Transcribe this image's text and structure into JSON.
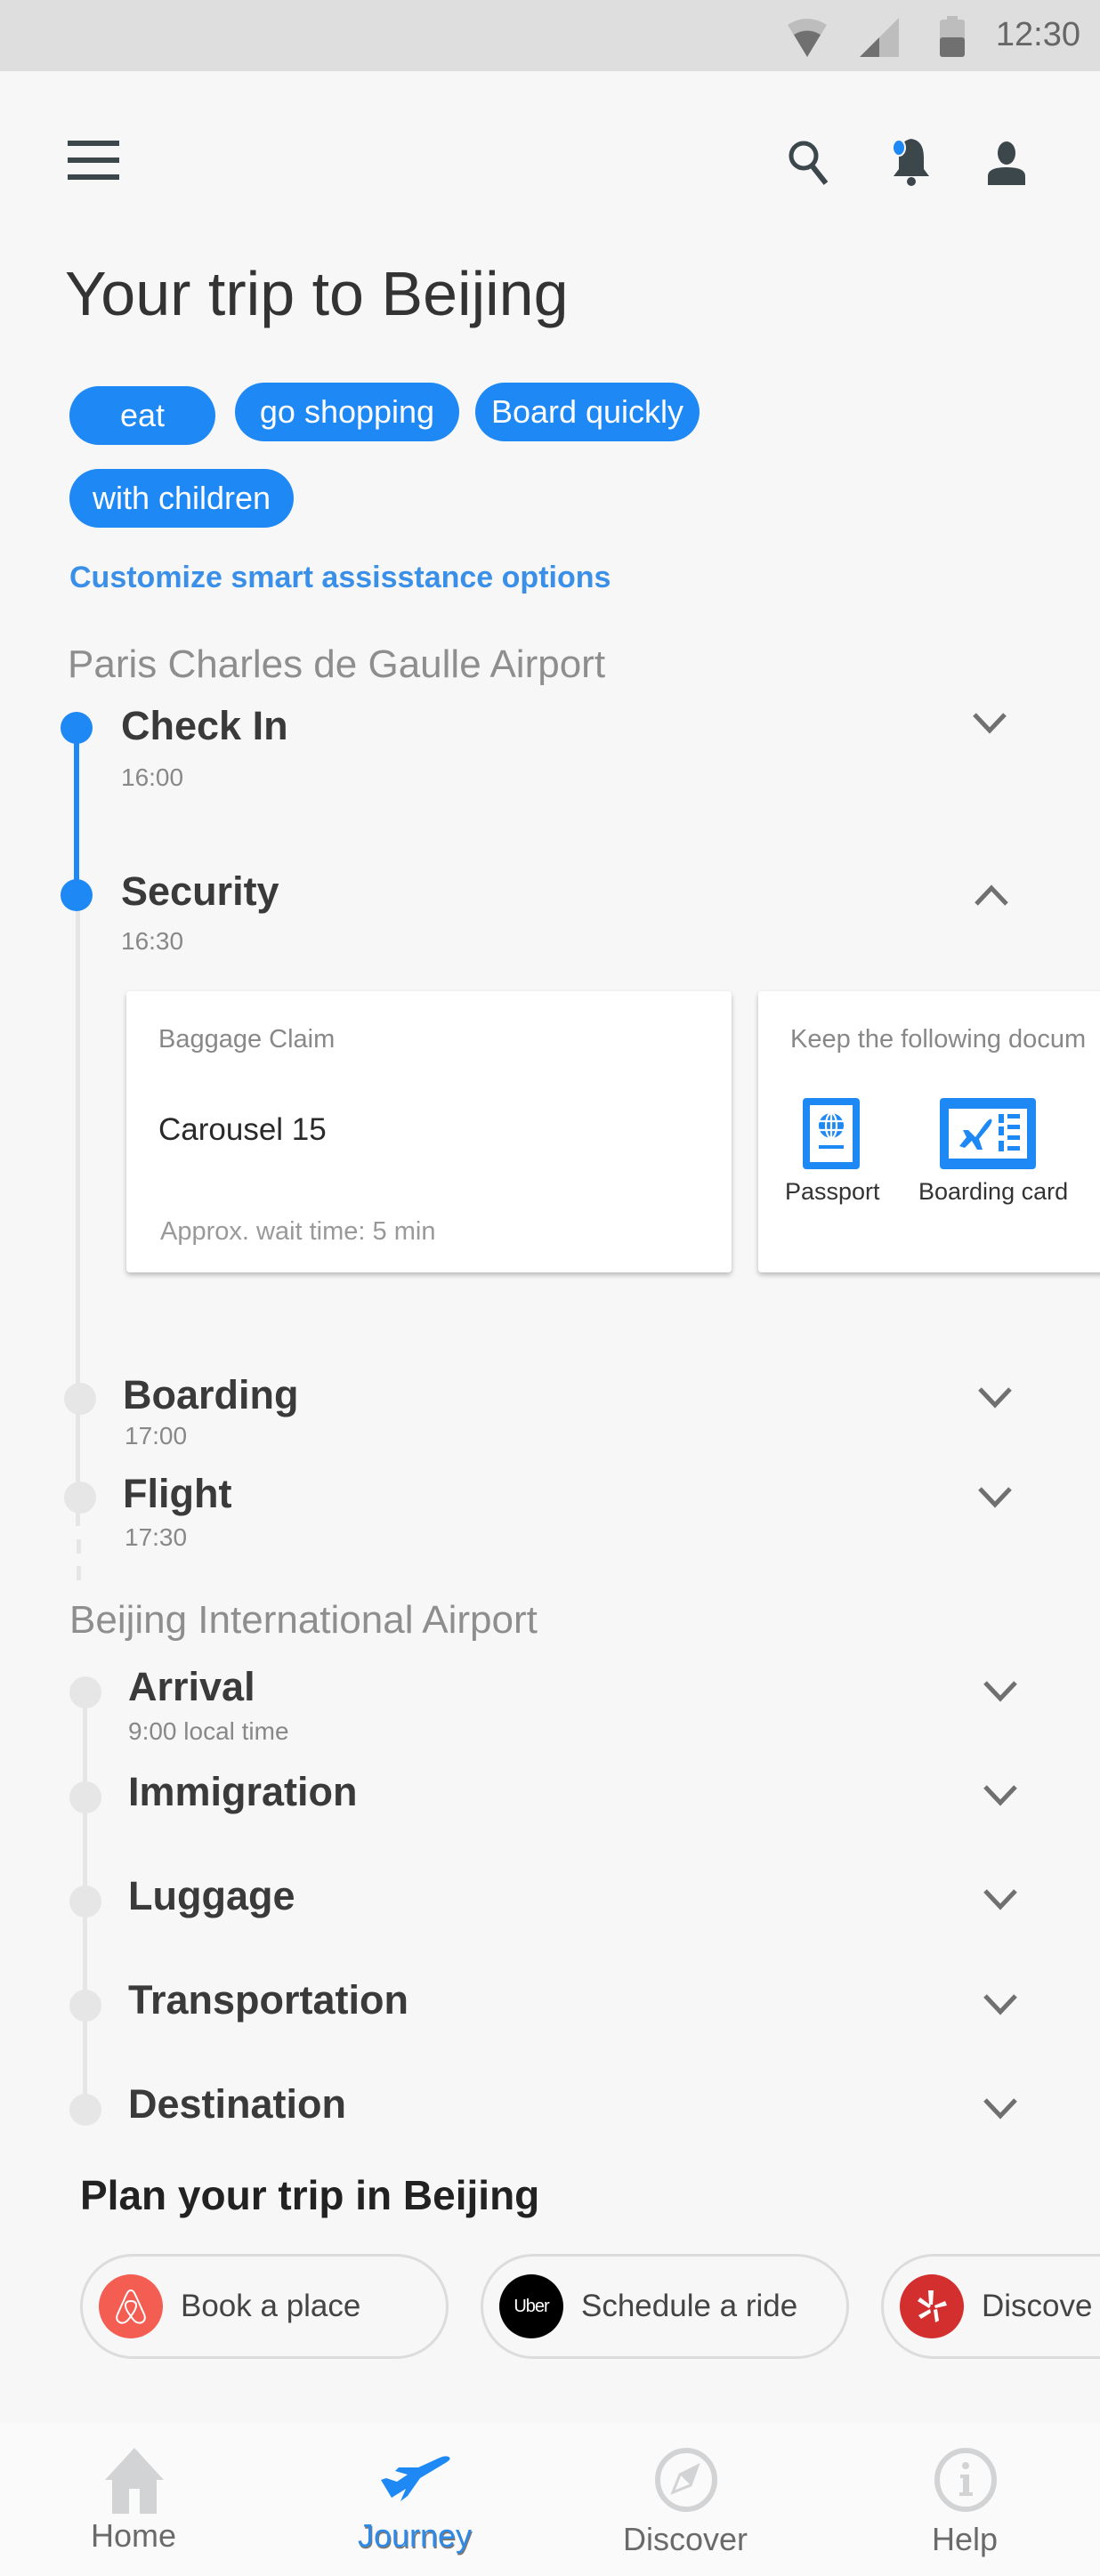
{
  "status_bar": {
    "time": "12:30",
    "icons": [
      "wifi-icon",
      "cellular-signal-icon",
      "battery-icon"
    ]
  },
  "app_bar": {
    "menu_icon": "hamburger-menu-icon",
    "actions": [
      "search-icon",
      "notification-bell-icon",
      "account-icon"
    ],
    "has_notification": true
  },
  "page_title": "Your trip to Beijing",
  "tags": [
    "eat",
    "go shopping",
    "Board quickly",
    "with children"
  ],
  "customize_link": "Customize smart assisstance options",
  "origin": {
    "airport": "Paris Charles de Gaulle Airport",
    "steps": [
      {
        "title": "Check In",
        "time": "16:00",
        "status": "done",
        "expanded": false
      },
      {
        "title": "Security",
        "time": "16:30",
        "status": "current",
        "expanded": true
      },
      {
        "title": "Boarding",
        "time": "17:00",
        "status": "upcoming",
        "expanded": false
      },
      {
        "title": "Flight",
        "time": "17:30",
        "status": "upcoming",
        "expanded": false
      }
    ],
    "security_cards": [
      {
        "label": "Baggage Claim",
        "value": "Carousel 15",
        "footer": "Approx. wait time: 5 min"
      },
      {
        "label": "Keep the following docum",
        "documents": [
          {
            "name": "Passport",
            "icon": "passport-icon"
          },
          {
            "name": "Boarding card",
            "icon": "boarding-pass-icon"
          }
        ]
      }
    ]
  },
  "destination": {
    "airport": "Beijing International Airport",
    "steps": [
      {
        "title": "Arrival",
        "time": "9:00 local time"
      },
      {
        "title": "Immigration",
        "time": ""
      },
      {
        "title": "Luggage",
        "time": ""
      },
      {
        "title": "Transportation",
        "time": ""
      },
      {
        "title": "Destination",
        "time": ""
      }
    ]
  },
  "plan": {
    "title": "Plan your trip in Beijing",
    "chips": [
      {
        "label": "Book a place",
        "logo": "airbnb-logo",
        "color": "#f35d52"
      },
      {
        "label": "Schedule a ride",
        "logo": "uber-logo",
        "logo_text": "Uber",
        "color": "#000000"
      },
      {
        "label": "Discove",
        "logo": "yelp-logo",
        "color": "#d32f2f"
      }
    ]
  },
  "bottom_nav": {
    "items": [
      {
        "label": "Home",
        "icon": "home-icon",
        "active": false
      },
      {
        "label": "Journey",
        "icon": "airplane-icon",
        "active": true
      },
      {
        "label": "Discover",
        "icon": "compass-icon",
        "active": false
      },
      {
        "label": "Help",
        "icon": "info-icon",
        "active": false
      }
    ]
  },
  "colors": {
    "accent": "#1e88f5",
    "link": "#3a90e8",
    "inactive": "#e6e6e6"
  }
}
